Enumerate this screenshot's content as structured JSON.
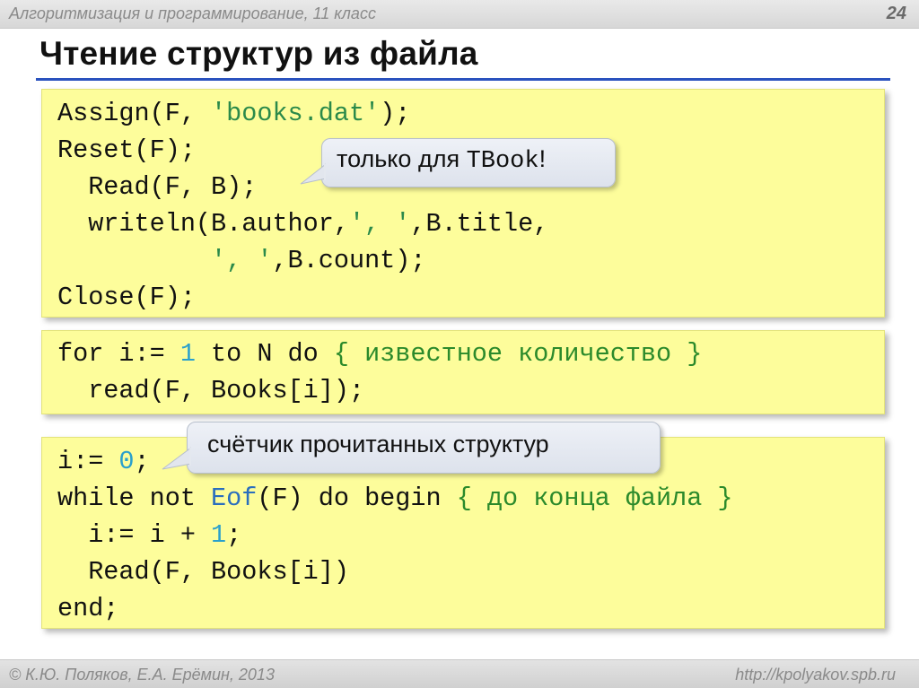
{
  "header": {
    "course": "Алгоритмизация и программирование, 11 класс",
    "page_number": "24"
  },
  "slide": {
    "title": "Чтение структур из файла"
  },
  "box1": {
    "line1": {
      "a": "Assign(F, ",
      "b": "'books.dat'",
      "c": ");"
    },
    "line2": "Reset(F);",
    "line3": "  Read(F, B);",
    "line4": {
      "a": "  writeln(B.author,",
      "b": "', '",
      "c": ",B.title,"
    },
    "line5": {
      "a": "          ",
      "b": "', '",
      "c": ",B.count);"
    },
    "line6": "Close(F);",
    "callout": {
      "text": "только для ",
      "mono": "TBook",
      "tail": "!"
    }
  },
  "box2": {
    "line1": {
      "a": "for i:= ",
      "b": "1",
      "c": " to N do ",
      "d": "{ известное количество }"
    },
    "line2": "  read(F, Books[i]);"
  },
  "box3": {
    "line1": {
      "a": "i:= ",
      "b": "0",
      "c": ";"
    },
    "line2": {
      "a": "while not ",
      "b": "Eof",
      "c": "(F) do begin ",
      "d": "{ до конца файла }"
    },
    "line3": {
      "a": "  i:= i + ",
      "b": "1",
      "c": ";"
    },
    "line4": "  Read(F, Books[i])",
    "line5": "end;",
    "callout": {
      "text": "счётчик прочитанных структур"
    }
  },
  "footer": {
    "copyright": "© К.Ю. Поляков, Е.А. Ерёмин, 2013",
    "url": "http://kpolyakov.spb.ru"
  }
}
